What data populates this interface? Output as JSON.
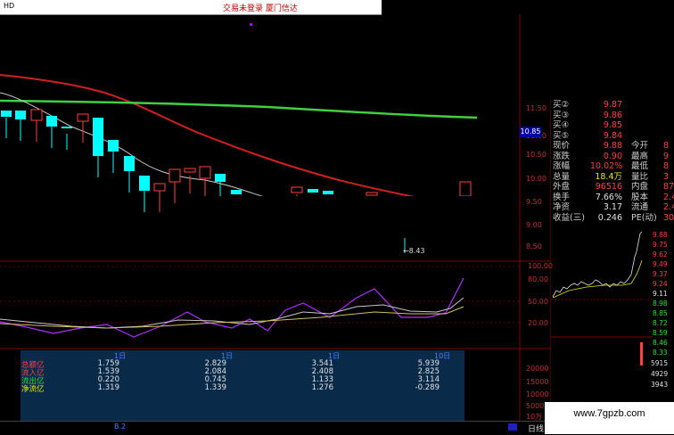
{
  "window": {
    "app_name": "HD",
    "status_text": "交易未登录  厦门信达"
  },
  "price_axis": [
    "11.50",
    "11.00",
    "10.50",
    "10.00",
    "9.50",
    "9.00",
    "8.50"
  ],
  "current_price_tag": "10.85",
  "low_annotation": "8.43",
  "indicator_axis": [
    "100.00",
    "80.00",
    "50.00",
    "20.00"
  ],
  "volume_axis": [
    "20000",
    "15000",
    "10000",
    "5000",
    "10万"
  ],
  "fund_flow": {
    "labels": [
      "总额亿",
      "流入亿",
      "流出亿",
      "净流亿"
    ],
    "label_colors": [
      "#ff4040",
      "#ff4040",
      "#30e030",
      "#e8e800"
    ],
    "columns": [
      {
        "date": "1日",
        "values": [
          "1.759",
          "1.539",
          "0.220",
          "1.319"
        ]
      },
      {
        "date": "1日",
        "values": [
          "2.829",
          "2.084",
          "0.745",
          "1.339"
        ]
      },
      {
        "date": "1日",
        "values": [
          "3.541",
          "2.408",
          "1.133",
          "1.276"
        ]
      },
      {
        "date": "10日",
        "values": [
          "5.939",
          "2.825",
          "3.114",
          "-0.289"
        ]
      }
    ]
  },
  "quote": {
    "bids": [
      {
        "label": "买②",
        "price": "9.87"
      },
      {
        "label": "买③",
        "price": "9.86"
      },
      {
        "label": "买④",
        "price": "9.85"
      },
      {
        "label": "买⑤",
        "price": "9.84"
      }
    ],
    "rows": [
      {
        "l1": "现价",
        "v1": "9.88",
        "c1": "red",
        "l2": "今开",
        "v2": "8"
      },
      {
        "l1": "涨跌",
        "v1": "0.90",
        "c1": "red",
        "l2": "最高",
        "v2": "9"
      },
      {
        "l1": "涨幅",
        "v1": "10.02%",
        "c1": "red",
        "l2": "最低",
        "v2": "8"
      },
      {
        "l1": "总量",
        "v1": "18.4万",
        "c1": "yellow",
        "l2": "量比",
        "v2": "3"
      },
      {
        "l1": "外盘",
        "v1": "96516",
        "c1": "red",
        "l2": "内盘",
        "v2": "874"
      },
      {
        "l1": "换手",
        "v1": "7.66%",
        "c1": "white",
        "l2": "股本",
        "v2": "2.40"
      },
      {
        "l1": "净资",
        "v1": "3.17",
        "c1": "white",
        "l2": "流通",
        "v2": "2.40"
      },
      {
        "l1": "收益(三)",
        "v1": "0.246",
        "c1": "white",
        "l2": "PE(动)",
        "v2": "30"
      }
    ]
  },
  "mini_axis": [
    "9.88",
    "9.75",
    "9.62",
    "9.49",
    "9.37",
    "9.24",
    "9.11",
    "8.98",
    "8.85",
    "8.72",
    "8.59",
    "8.46",
    "8.33"
  ],
  "mini_volume_axis": [
    "5915",
    "4929",
    "3943"
  ],
  "bottom": {
    "tab_daily": "日线",
    "left_marker": "B.2"
  },
  "watermark": "www.7gpzb.com",
  "colors": {
    "up": "#ff4040",
    "down": "#00ffff",
    "ma_red": "#d02020",
    "ma_green": "#40d040",
    "ma_white": "#c8c8c8"
  }
}
